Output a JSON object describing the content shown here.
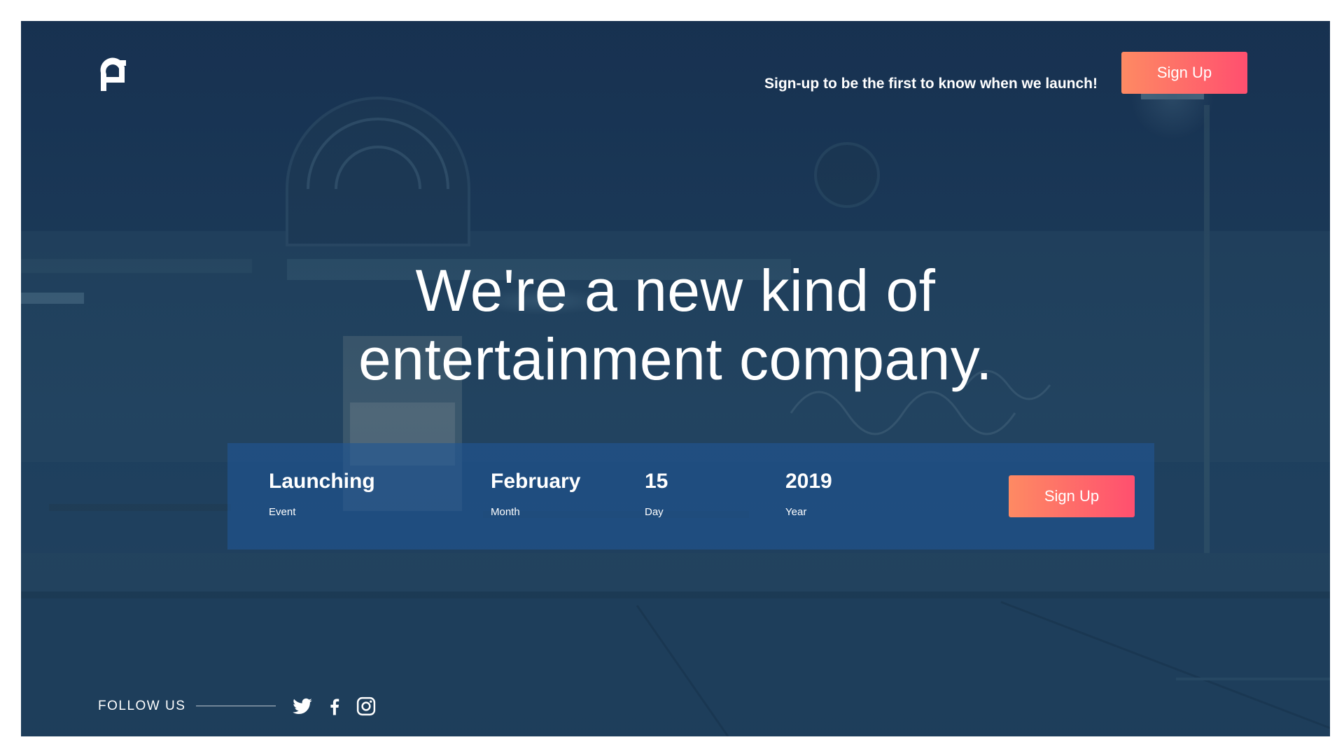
{
  "header": {
    "tagline": "Sign-up to be the first to know when we launch!",
    "signup_label": "Sign Up"
  },
  "hero": {
    "title_line1": "We're a new kind of",
    "title_line2": "entertainment company."
  },
  "launch": {
    "items": [
      {
        "value": "Launching",
        "label": "Event"
      },
      {
        "value": "February",
        "label": "Month"
      },
      {
        "value": "15",
        "label": "Day"
      },
      {
        "value": "2019",
        "label": "Year"
      }
    ],
    "signup_label": "Sign Up"
  },
  "footer": {
    "follow_label": "FOLLOW US",
    "social_icons": [
      "twitter-icon",
      "facebook-icon",
      "instagram-icon"
    ]
  },
  "colors": {
    "accent_start": "#fe8a63",
    "accent_end": "#ff4f6f",
    "overlay": "#1a3552"
  }
}
